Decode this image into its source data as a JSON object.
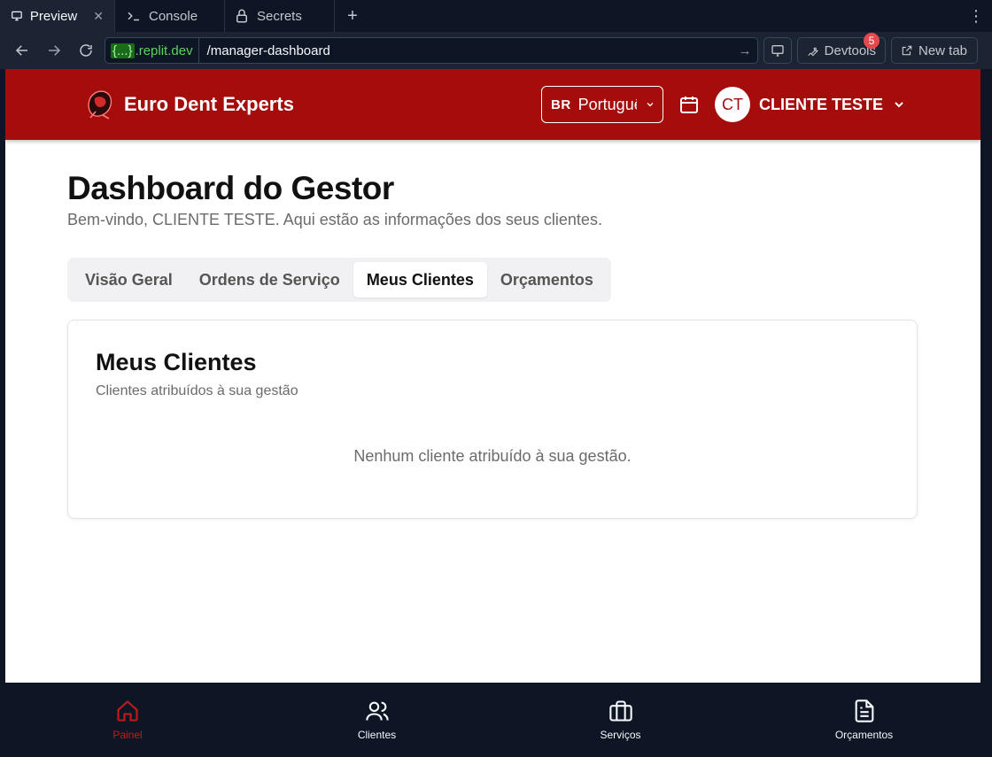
{
  "workspace_tabs": [
    {
      "label": "Preview",
      "icon": "monitor-icon",
      "active": true,
      "closable": true
    },
    {
      "label": "Console",
      "icon": "terminal-icon",
      "active": false
    },
    {
      "label": "Secrets",
      "icon": "lock-icon",
      "active": false
    }
  ],
  "toolbar": {
    "domain_braces": "{...}",
    "domain_suffix": ".replit.dev",
    "path": "/manager-dashboard",
    "devtools_label": "Devtools",
    "devtools_badge": "5",
    "new_tab_label": "New tab"
  },
  "header": {
    "brand_name": "Euro Dent Experts",
    "lang_code": "BR",
    "lang_name": "Português",
    "avatar_initials": "CT",
    "user_name": "CLIENTE TESTE",
    "brand_color": "#a50d0d"
  },
  "page": {
    "title": "Dashboard do Gestor",
    "subtitle": "Bem-vindo, CLIENTE TESTE. Aqui estão as informações dos seus clientes."
  },
  "tabs": [
    {
      "label": "Visão Geral",
      "active": false
    },
    {
      "label": "Ordens de Serviço",
      "active": false
    },
    {
      "label": "Meus Clientes",
      "active": true
    },
    {
      "label": "Orçamentos",
      "active": false
    }
  ],
  "card": {
    "title": "Meus Clientes",
    "subtitle": "Clientes atribuídos à sua gestão",
    "empty_message": "Nenhum cliente atribuído à sua gestão."
  },
  "bottom_nav": [
    {
      "label": "Painel",
      "icon": "home-icon",
      "active": true
    },
    {
      "label": "Clientes",
      "icon": "users-icon",
      "active": false
    },
    {
      "label": "Serviços",
      "icon": "briefcase-icon",
      "active": false
    },
    {
      "label": "Orçamentos",
      "icon": "document-icon",
      "active": false
    }
  ]
}
